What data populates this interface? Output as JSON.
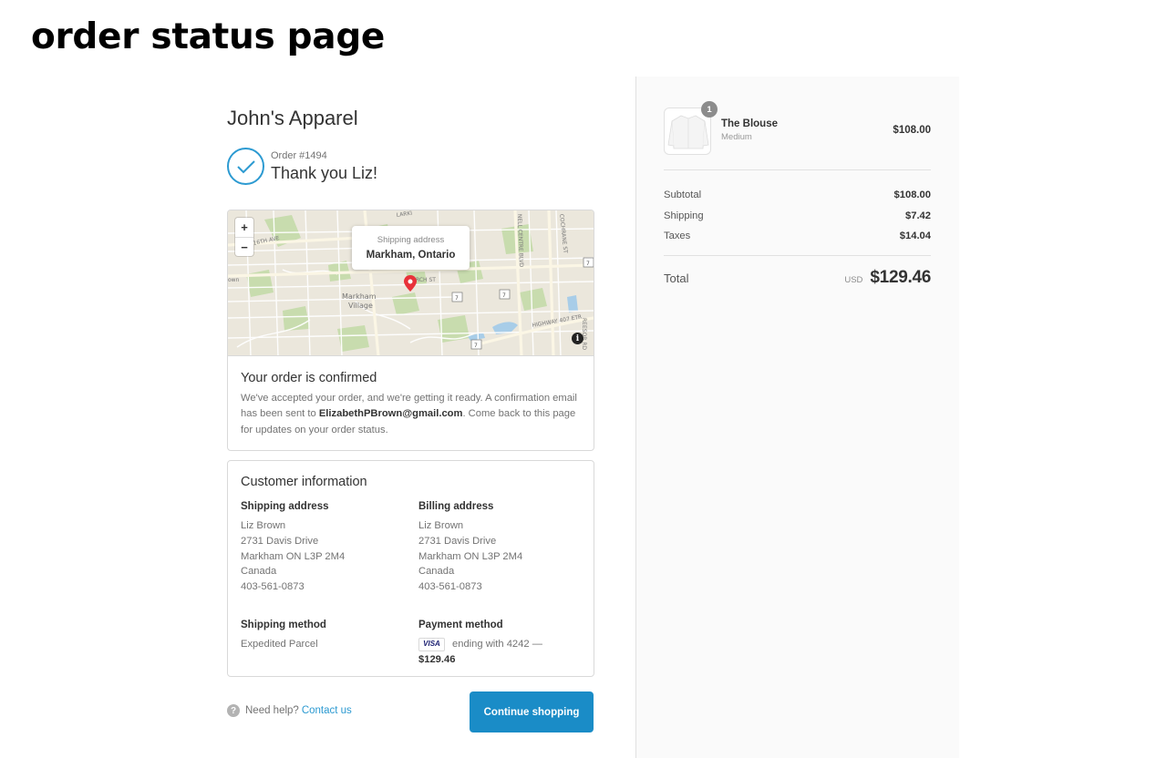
{
  "page": {
    "heading": "order status page"
  },
  "shop": {
    "name": "John's Apparel"
  },
  "order": {
    "number": "Order #1494",
    "thank_you": "Thank you Liz!"
  },
  "map": {
    "zoom_in": "+",
    "zoom_out": "−",
    "popup_label": "Shipping address",
    "popup_city": "Markham, Ontario",
    "info_glyph": "i",
    "labels": {
      "village": "Markham",
      "village2": "Village",
      "street_16th": "16TH AVE",
      "street_larkin": "LARKI",
      "street_church": "RCH ST",
      "street_centre": "NELL CENTRE BLVD",
      "street_cochrane": "COCHRANE ST",
      "street_highway": "HIGHWAY 407 ETR",
      "street_reesor": "REESOR RD",
      "route_7a": "7",
      "route_7b": "7",
      "route_7c": "7",
      "route_7d": "7",
      "town_edge": "own"
    }
  },
  "confirmation": {
    "title": "Your order is confirmed",
    "text_before": "We've accepted your order, and we're getting it ready. A confirmation email has been sent to ",
    "email": "ElizabethPBrown@gmail.com",
    "text_after": ". Come back to this page for updates on your order status."
  },
  "customer": {
    "title": "Customer information",
    "shipping_address": {
      "heading": "Shipping address",
      "lines": [
        "Liz Brown",
        "2731 Davis Drive",
        "Markham ON L3P 2M4",
        "Canada",
        "403-561-0873"
      ]
    },
    "billing_address": {
      "heading": "Billing address",
      "lines": [
        "Liz Brown",
        "2731 Davis Drive",
        "Markham ON L3P 2M4",
        "Canada",
        "403-561-0873"
      ]
    },
    "shipping_method": {
      "heading": "Shipping method",
      "value": "Expedited Parcel"
    },
    "payment_method": {
      "heading": "Payment method",
      "card_brand": "VISA",
      "ending": "ending with 4242 —",
      "amount": "$129.46"
    }
  },
  "footer": {
    "help_glyph": "?",
    "help_text": "Need help?",
    "contact_link": "Contact us",
    "continue_button": "Continue shopping"
  },
  "summary": {
    "product": {
      "quantity": "1",
      "name": "The Blouse",
      "variant": "Medium",
      "price": "$108.00"
    },
    "subtotal": {
      "label": "Subtotal",
      "value": "$108.00"
    },
    "shipping": {
      "label": "Shipping",
      "value": "$7.42"
    },
    "taxes": {
      "label": "Taxes",
      "value": "$14.04"
    },
    "total": {
      "label": "Total",
      "currency": "USD",
      "value": "$129.46"
    }
  },
  "colors": {
    "accent": "#1a8cc7",
    "link": "#2c9ad1",
    "summary_bg": "#fafafa",
    "pin": "#e8323a"
  }
}
